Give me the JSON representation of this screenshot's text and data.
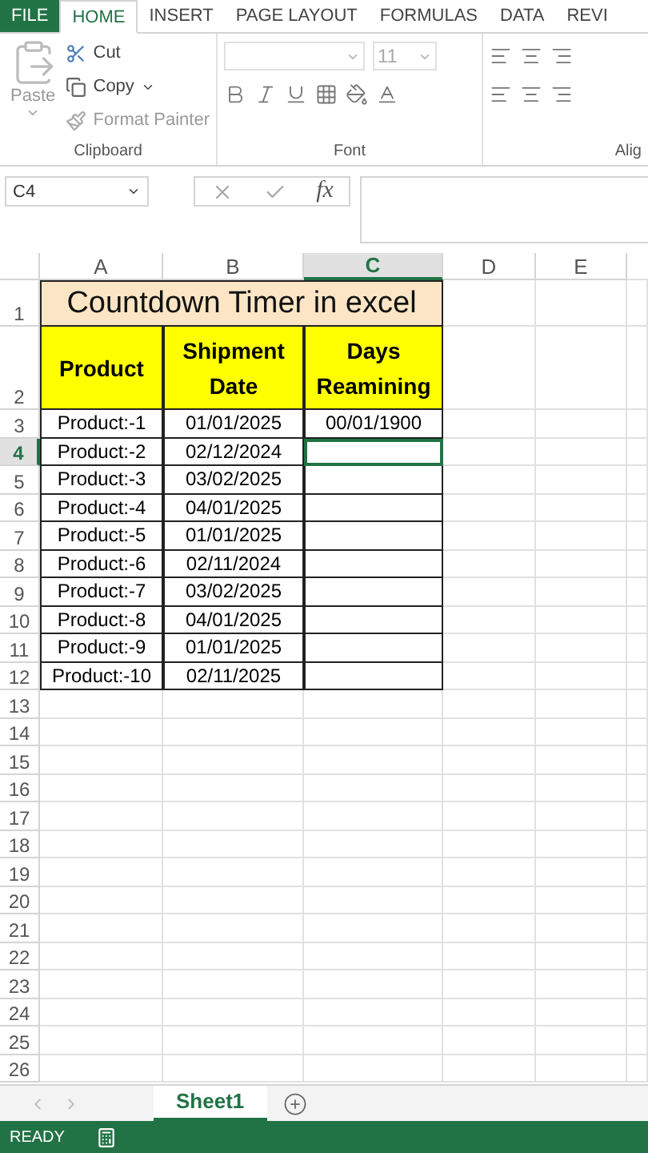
{
  "ribbon_tabs": [
    {
      "label": "FILE",
      "kind": "file",
      "selected": false
    },
    {
      "label": "HOME",
      "kind": "tab",
      "selected": true
    },
    {
      "label": "INSERT",
      "kind": "tab",
      "selected": false
    },
    {
      "label": "PAGE LAYOUT",
      "kind": "tab",
      "selected": false
    },
    {
      "label": "FORMULAS",
      "kind": "tab",
      "selected": false
    },
    {
      "label": "DATA",
      "kind": "tab",
      "selected": false
    },
    {
      "label": "REVI",
      "kind": "tab",
      "selected": false
    }
  ],
  "clipboard": {
    "paste": "Paste",
    "cut": "Cut",
    "copy": "Copy",
    "format_painter": "Format Painter",
    "group_label": "Clipboard"
  },
  "font": {
    "size": "11",
    "group_label": "Font"
  },
  "alignment": {
    "group_label": "Alig"
  },
  "formula_bar": {
    "name_box": "C4",
    "fx": "fx"
  },
  "columns": [
    {
      "label": "A",
      "selected": false
    },
    {
      "label": "B",
      "selected": false
    },
    {
      "label": "C",
      "selected": true
    },
    {
      "label": "D",
      "selected": false
    },
    {
      "label": "E",
      "selected": false
    }
  ],
  "title": {
    "row": "1",
    "text": "Countdown Timer in excel"
  },
  "header": {
    "row": "2",
    "cells": [
      "Product",
      "Shipment Date",
      "Days Reamining"
    ]
  },
  "rows": [
    {
      "number": "3",
      "selected": false,
      "cells": [
        "Product:-1",
        "01/01/2025",
        "00/01/1900"
      ]
    },
    {
      "number": "4",
      "selected": true,
      "cells": [
        "Product:-2",
        "02/12/2024",
        ""
      ]
    },
    {
      "number": "5",
      "selected": false,
      "cells": [
        "Product:-3",
        "03/02/2025",
        ""
      ]
    },
    {
      "number": "6",
      "selected": false,
      "cells": [
        "Product:-4",
        "04/01/2025",
        ""
      ]
    },
    {
      "number": "7",
      "selected": false,
      "cells": [
        "Product:-5",
        "01/01/2025",
        ""
      ]
    },
    {
      "number": "8",
      "selected": false,
      "cells": [
        "Product:-6",
        "02/11/2024",
        ""
      ]
    },
    {
      "number": "9",
      "selected": false,
      "cells": [
        "Product:-7",
        "03/02/2025",
        ""
      ]
    },
    {
      "number": "10",
      "selected": false,
      "cells": [
        "Product:-8",
        "04/01/2025",
        ""
      ]
    },
    {
      "number": "11",
      "selected": false,
      "cells": [
        "Product:-9",
        "01/01/2025",
        ""
      ]
    },
    {
      "number": "12",
      "selected": false,
      "cells": [
        "Product:-10",
        "02/11/2025",
        ""
      ]
    }
  ],
  "empty_rows": [
    "13",
    "14",
    "15",
    "16",
    "17",
    "18",
    "19",
    "20",
    "21",
    "22",
    "23",
    "24",
    "25",
    "26"
  ],
  "sheet_tabs": [
    {
      "label": "Sheet1",
      "selected": true
    }
  ],
  "status": {
    "text": "READY"
  }
}
